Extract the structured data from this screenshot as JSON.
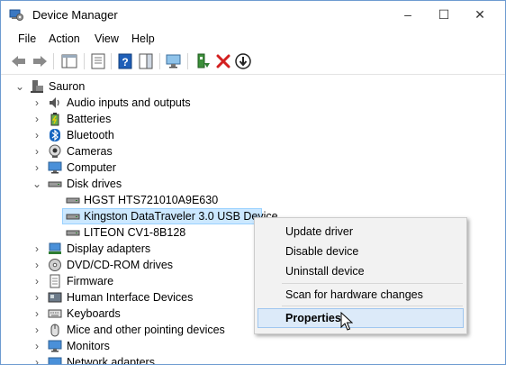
{
  "window": {
    "title": "Device Manager"
  },
  "window_controls": {
    "minimize": "–",
    "maximize": "☐",
    "close": "✕"
  },
  "menu": [
    "File",
    "Action",
    "View",
    "Help"
  ],
  "tree": {
    "root": "Sauron",
    "categories": [
      "Audio inputs and outputs",
      "Batteries",
      "Bluetooth",
      "Cameras",
      "Computer",
      "Disk drives",
      "Display adapters",
      "DVD/CD-ROM drives",
      "Firmware",
      "Human Interface Devices",
      "Keyboards",
      "Mice and other pointing devices",
      "Monitors",
      "Network adapters"
    ],
    "disk_drives": [
      "HGST HTS721010A9E630",
      "Kingston DataTraveler 3.0 USB Device",
      "LITEON CV1-8B128"
    ]
  },
  "context_menu": {
    "items": [
      "Update driver",
      "Disable device",
      "Uninstall device"
    ],
    "scan": "Scan for hardware changes",
    "properties": "Properties"
  },
  "colors": {
    "selection": "#cce8ff",
    "menu_highlight": "#dceaf9",
    "border": "#6d9bd1"
  }
}
